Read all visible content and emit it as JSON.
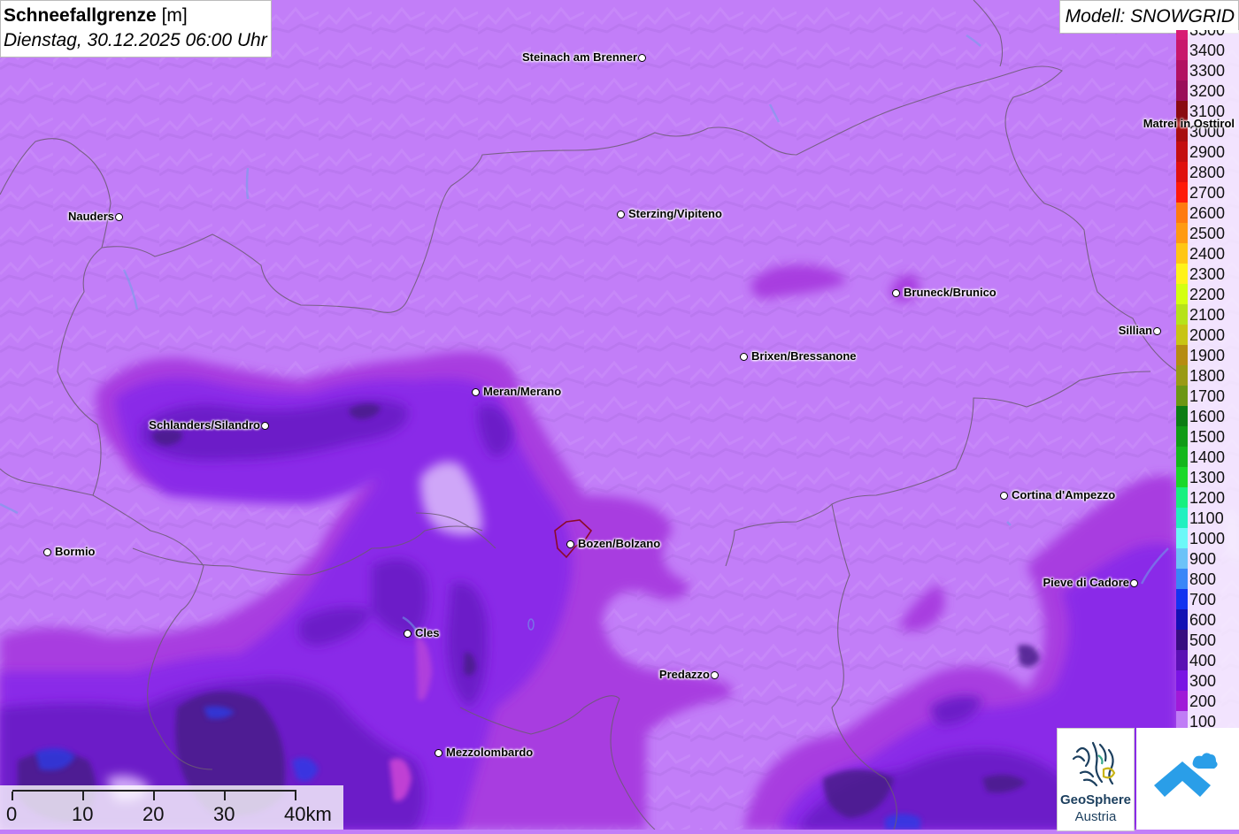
{
  "title": {
    "main": "Schneefallgrenze",
    "unit": "[m]",
    "datetime": "Dienstag, 30.12.2025 06:00 Uhr"
  },
  "model": "Modell: SNOWGRID",
  "legend": {
    "items": [
      {
        "label": "3500",
        "color": "#d81b74"
      },
      {
        "label": "3400",
        "color": "#c8166c"
      },
      {
        "label": "3300",
        "color": "#b21163"
      },
      {
        "label": "3200",
        "color": "#9a0d5a"
      },
      {
        "label": "3100",
        "color": "#8a0a12"
      },
      {
        "label": "3000",
        "color": "#a80d10"
      },
      {
        "label": "2900",
        "color": "#c40e10"
      },
      {
        "label": "2800",
        "color": "#e0100e"
      },
      {
        "label": "2700",
        "color": "#ff1a0a"
      },
      {
        "label": "2600",
        "color": "#ff7a10"
      },
      {
        "label": "2500",
        "color": "#ff9a12"
      },
      {
        "label": "2400",
        "color": "#ffc614"
      },
      {
        "label": "2300",
        "color": "#fff21a"
      },
      {
        "label": "2200",
        "color": "#d4ff10"
      },
      {
        "label": "2100",
        "color": "#b6e21a"
      },
      {
        "label": "2000",
        "color": "#c8c414"
      },
      {
        "label": "1900",
        "color": "#b68c12"
      },
      {
        "label": "1800",
        "color": "#9a9a14"
      },
      {
        "label": "1700",
        "color": "#6c9614"
      },
      {
        "label": "1600",
        "color": "#0c7c14"
      },
      {
        "label": "1500",
        "color": "#109a16"
      },
      {
        "label": "1400",
        "color": "#14b61c"
      },
      {
        "label": "1300",
        "color": "#1ad82a"
      },
      {
        "label": "1200",
        "color": "#18f080"
      },
      {
        "label": "1100",
        "color": "#22f0c0"
      },
      {
        "label": "1000",
        "color": "#6cf8f8"
      },
      {
        "label": "900",
        "color": "#6cc2f8"
      },
      {
        "label": "800",
        "color": "#3a86f8"
      },
      {
        "label": "700",
        "color": "#1432f0"
      },
      {
        "label": "600",
        "color": "#1410b4"
      },
      {
        "label": "500",
        "color": "#380c80"
      },
      {
        "label": "400",
        "color": "#5a10b4"
      },
      {
        "label": "300",
        "color": "#7a14e4"
      },
      {
        "label": "200",
        "color": "#a01ad8"
      },
      {
        "label": "100",
        "color": "#c07cf6"
      }
    ]
  },
  "cities": [
    {
      "name": "Steinach am Brenner",
      "label_side": "left"
    },
    {
      "name": "Nauders",
      "label_side": "left"
    },
    {
      "name": "Sterzing/Vipiteno",
      "label_side": "right"
    },
    {
      "name": "Matrei in Osttirol",
      "label_side": "left"
    },
    {
      "name": "Bruneck/Brunico",
      "label_side": "right"
    },
    {
      "name": "Sillian",
      "label_side": "left"
    },
    {
      "name": "Brixen/Bressanone",
      "label_side": "right"
    },
    {
      "name": "Meran/Merano",
      "label_side": "right"
    },
    {
      "name": "Schlanders/Silandro",
      "label_side": "left"
    },
    {
      "name": "Cortina d'Ampezzo",
      "label_side": "right"
    },
    {
      "name": "Bormio",
      "label_side": "right"
    },
    {
      "name": "Bozen/Bolzano",
      "label_side": "right"
    },
    {
      "name": "Pieve di Cadore",
      "label_side": "left"
    },
    {
      "name": "Cles",
      "label_side": "right"
    },
    {
      "name": "Predazzo",
      "label_side": "left"
    },
    {
      "name": "Mezzolombardo",
      "label_side": "right"
    }
  ],
  "scale": {
    "labels": [
      "0",
      "10",
      "20",
      "30",
      "40km"
    ]
  },
  "logos": {
    "geosphere_line1": "GeoSphere",
    "geosphere_line2": "Austria"
  }
}
